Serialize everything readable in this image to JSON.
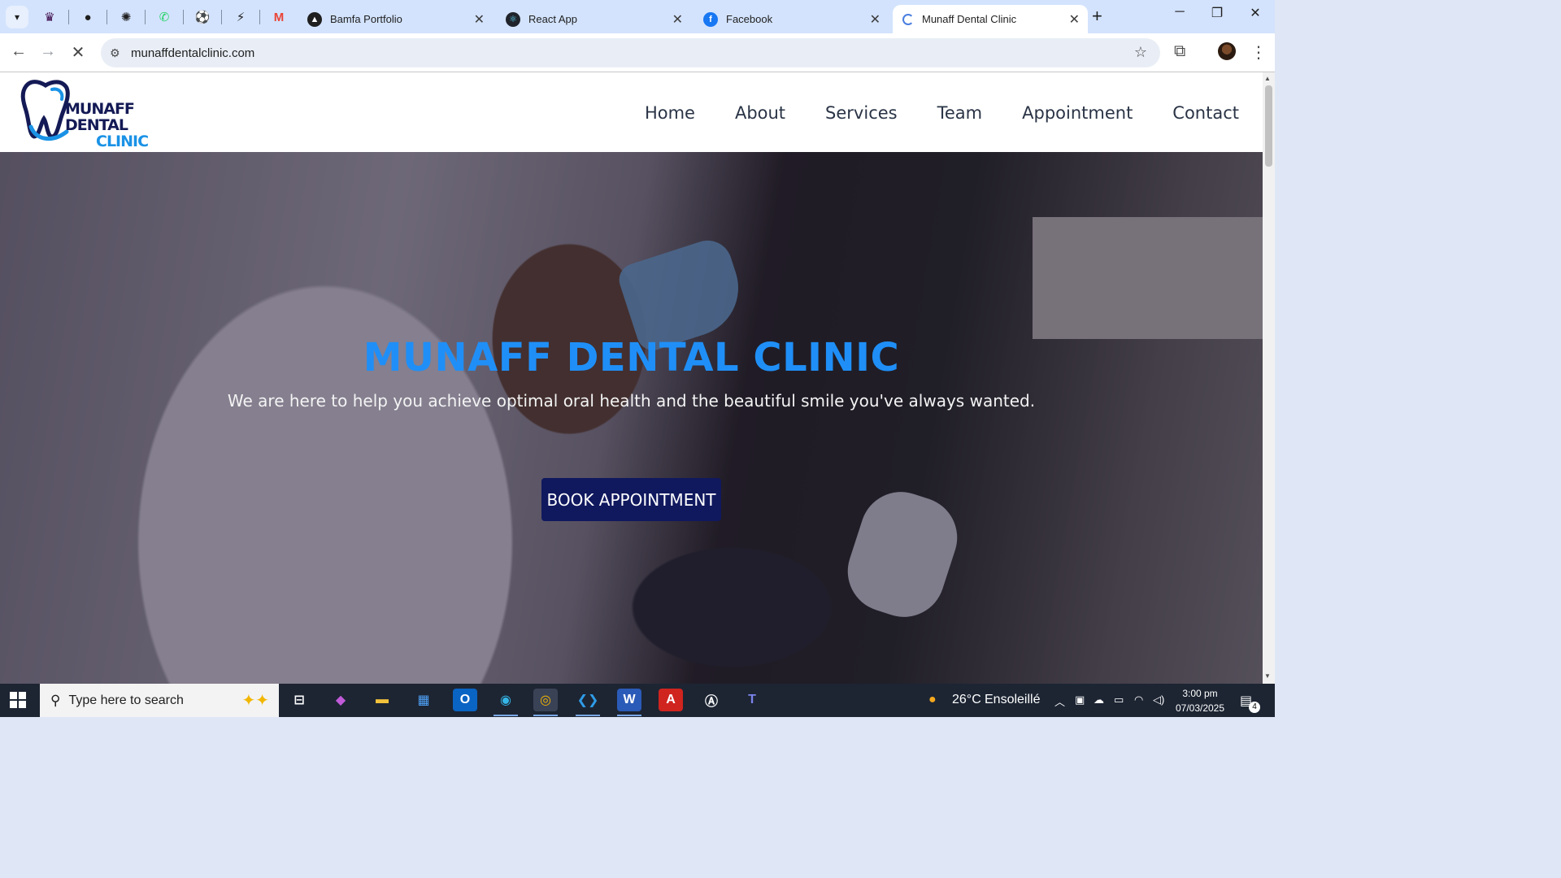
{
  "browser": {
    "tabs": [
      {
        "title": "Bamfa Portfolio",
        "favicon": "triangle-logo-icon"
      },
      {
        "title": "React App",
        "favicon": "react-icon"
      },
      {
        "title": "Facebook",
        "favicon": "facebook-icon"
      },
      {
        "title": "Munaff Dental Clinic",
        "favicon": "loading-icon",
        "active": true
      }
    ],
    "pinned_tabs": [
      "premier-league-icon",
      "github-icon",
      "openai-icon",
      "whatsapp-icon",
      "football-icon",
      "bolt-icon",
      "gmail-icon"
    ],
    "url": "munaffdentalclinic.com"
  },
  "site": {
    "logo": {
      "line1": "MUNAFF DENTAL",
      "line2": "CLINIC"
    },
    "nav": [
      "Home",
      "About",
      "Services",
      "Team",
      "Appointment",
      "Contact"
    ],
    "hero": {
      "title": "MUNAFF DENTAL CLINIC",
      "subtitle": "We are here to help you achieve optimal oral health and the beautiful smile you've always wanted.",
      "cta": "BOOK APPOINTMENT"
    }
  },
  "taskbar": {
    "search_placeholder": "Type here to search",
    "weather": {
      "temp": "26°C",
      "condition": "Ensoleillé"
    },
    "time": "3:00 pm",
    "date": "07/03/2025",
    "notification_count": "4"
  },
  "colors": {
    "brand_navy": "#10185e",
    "brand_blue": "#1f8ff7",
    "tabstrip": "#d3e3fd"
  }
}
